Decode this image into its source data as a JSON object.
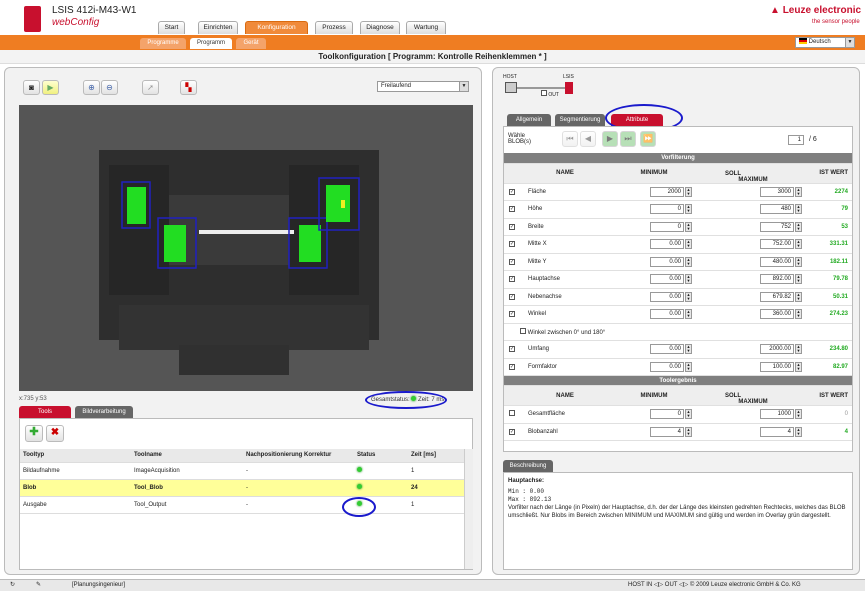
{
  "app": {
    "title": "LSIS 412i-M43-W1",
    "subtitle": "webConfig",
    "brand": "Leuze electronic",
    "tagline": "the sensor people",
    "lang": "Deutsch"
  },
  "main_tabs": [
    "Start",
    "Einrichten",
    "Konfiguration",
    "Prozess",
    "Diagnose",
    "Wartung"
  ],
  "sub_tabs": [
    "Programme",
    "Programm",
    "Gerät"
  ],
  "page_title": "Toolkonfiguration   [ Programm: Kontrolle Reihenklemmen * ]",
  "left": {
    "mode_select": "Freilaufend",
    "coords": "x:735 y:53",
    "gesamtstatus": "Gesamtstatus:",
    "zeit": "Zeit: 7 ms",
    "tabs": [
      "Tools",
      "Bildverarbeitung"
    ],
    "columns": [
      "Tooltyp",
      "Toolname",
      "Nachpositionierung Korrektur",
      "Status",
      "Zeit [ms]"
    ],
    "rows": [
      {
        "typ": "Bildaufnahme",
        "name": "ImageAcquisition",
        "nach": "-",
        "zeit": "1"
      },
      {
        "typ": "Blob",
        "name": "Tool_Blob",
        "nach": "-",
        "zeit": "24"
      },
      {
        "typ": "Ausgabe",
        "name": "Tool_Output",
        "nach": "-",
        "zeit": "1"
      }
    ]
  },
  "right": {
    "host": "HOST",
    "lsis": "LSIS",
    "out": "OUT",
    "tabs": [
      "Allgemein",
      "Segmentierung",
      "Attribute"
    ],
    "blob_label": "Wähle BLOB(s)",
    "blob_count": "1",
    "blob_total": "/ 6",
    "vorfilterung": "Vorfilterung",
    "toolergebnis": "Toolergebnis",
    "col_name": "NAME",
    "col_soll": "SOLL",
    "col_min": "MINIMUM",
    "col_max": "MAXIMUM",
    "col_ist": "IST WERT",
    "pre_rows": [
      {
        "name": "Fläche",
        "min": "2000",
        "max": "3000",
        "ist": "2274"
      },
      {
        "name": "Höhe",
        "min": "0",
        "max": "480",
        "ist": "79"
      },
      {
        "name": "Breite",
        "min": "0",
        "max": "752",
        "ist": "53"
      },
      {
        "name": "Mitte X",
        "min": "0.00",
        "max": "752.00",
        "ist": "331.31"
      },
      {
        "name": "Mitte Y",
        "min": "0.00",
        "max": "480.00",
        "ist": "182.11"
      },
      {
        "name": "Hauptachse",
        "min": "0.00",
        "max": "892.00",
        "ist": "79.78"
      },
      {
        "name": "Nebenachse",
        "min": "0.00",
        "max": "679.82",
        "ist": "50.31"
      },
      {
        "name": "Winkel",
        "min": "0.00",
        "max": "360.00",
        "ist": "274.23"
      }
    ],
    "winkel_note": "Winkel zwischen 0° und 180°",
    "pre_rows2": [
      {
        "name": "Umfang",
        "min": "0.00",
        "max": "2000.00",
        "ist": "234.80"
      },
      {
        "name": "Formfaktor",
        "min": "0.00",
        "max": "100.00",
        "ist": "82.97"
      }
    ],
    "res_rows": [
      {
        "name": "Gesamtfläche",
        "min": "0",
        "max": "1000",
        "ist": "0"
      },
      {
        "name": "Blobanzahl",
        "min": "4",
        "max": "4",
        "ist": "4"
      }
    ],
    "desc_tab": "Beschreibung",
    "desc_title": "Hauptachse:",
    "desc_min": "Min : 0.00",
    "desc_max": "Max : 892.13",
    "desc_text": "Vorfilter nach der Länge (in Pixeln) der Hauptachse, d.h. der der Länge des kleinsten gedrehten Rechtecks, welches das BLOB umschließt. Nur Blobs im Bereich zwischen MINIMUM und MAXIMUM sind gültig und werden im Overlay grün dargestellt."
  },
  "status": {
    "user": "[Planungsingenieur]",
    "right": "HOST IN ◁▷ OUT ◁▷  © 2009 Leuze electronic GmbH & Co. KG"
  }
}
